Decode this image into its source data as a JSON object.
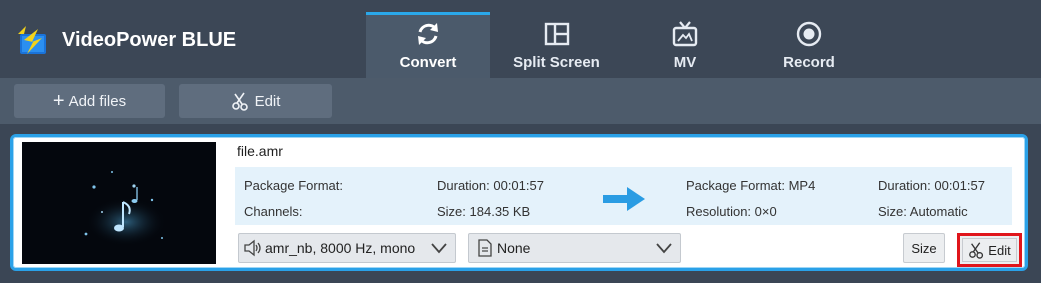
{
  "app": {
    "name": "VideoPower BLUE"
  },
  "nav": {
    "tabs": [
      {
        "label": "Convert",
        "icon": "refresh-icon",
        "active": true
      },
      {
        "label": "Split Screen",
        "icon": "split-screen-icon",
        "active": false
      },
      {
        "label": "MV",
        "icon": "tv-icon",
        "active": false
      },
      {
        "label": "Record",
        "icon": "record-icon",
        "active": false
      }
    ]
  },
  "toolbar": {
    "add_files_label": "Add files",
    "edit_label": "Edit"
  },
  "file": {
    "name": "file.amr",
    "source": {
      "package_format": "Package Format:",
      "channels": "Channels:",
      "duration": "Duration: 00:01:57",
      "size": "Size: 184.35 KB"
    },
    "target": {
      "package_format": "Package Format: MP4",
      "resolution": "Resolution: 0×0",
      "duration": "Duration: 00:01:57",
      "size": "Size: Automatic"
    },
    "audio_track": "amr_nb, 8000 Hz, mono",
    "subtitle": "None",
    "size_button": "Size",
    "edit_button": "Edit"
  },
  "colors": {
    "accent": "#2aa1e8",
    "highlight_box": "#e0151b",
    "header_bg": "#3c4756",
    "toolbar_bg": "#4d5b6b"
  }
}
